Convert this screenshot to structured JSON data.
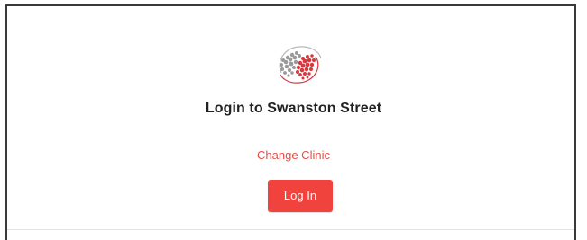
{
  "login": {
    "title": "Login to Swanston Street",
    "change_clinic_label": "Change Clinic",
    "login_button_label": "Log In"
  },
  "icons": {
    "logo": "clinic-globe-logo"
  },
  "colors": {
    "accent": "#f0433e",
    "link": "#e0514b",
    "logo_grey": "#9a9a9a",
    "logo_red": "#d9373d"
  }
}
